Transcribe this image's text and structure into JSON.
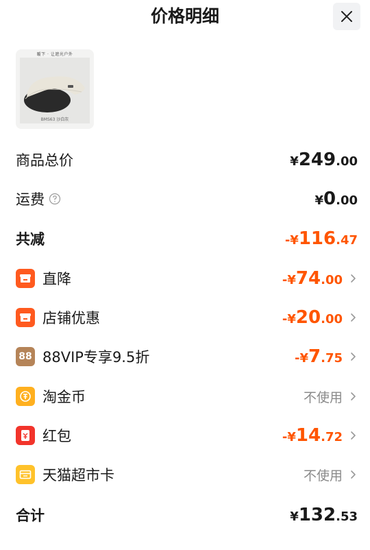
{
  "header": {
    "title": "价格明细"
  },
  "product": {
    "image_top_text": "暖下 · 让遮光户外",
    "image_bottom_text": "BMS63 沙白灰"
  },
  "rows": {
    "subtotal": {
      "label": "商品总价",
      "amount": {
        "sign": "",
        "currency": "¥",
        "integer": "249",
        "decimal": ".00"
      }
    },
    "shipping": {
      "label": "运费",
      "amount": {
        "sign": "",
        "currency": "¥",
        "integer": "0",
        "decimal": ".00"
      }
    },
    "total_reduction": {
      "label": "共减",
      "amount": {
        "sign": "-",
        "currency": "¥",
        "integer": "116",
        "decimal": ".47"
      }
    },
    "direct_discount": {
      "label": "直降",
      "amount": {
        "sign": "-",
        "currency": "¥",
        "integer": "74",
        "decimal": ".00"
      }
    },
    "shop_discount": {
      "label": "店铺优惠",
      "amount": {
        "sign": "-",
        "currency": "¥",
        "integer": "20",
        "decimal": ".00"
      }
    },
    "vip_discount": {
      "label": "88VIP专享9.5折",
      "icon_text": "88",
      "amount": {
        "sign": "-",
        "currency": "¥",
        "integer": "7",
        "decimal": ".75"
      }
    },
    "taojinbi": {
      "label": "淘金币",
      "status": "不使用"
    },
    "red_packet": {
      "label": "红包",
      "amount": {
        "sign": "-",
        "currency": "¥",
        "integer": "14",
        "decimal": ".72"
      }
    },
    "tmall_card": {
      "label": "天猫超市卡",
      "status": "不使用"
    },
    "grand_total": {
      "label": "合计",
      "amount": {
        "sign": "",
        "currency": "¥",
        "integer": "132",
        "decimal": ".53"
      }
    }
  },
  "colors": {
    "discount": "#ff5500",
    "muted": "#8a8a8a",
    "orange_icon": "#ff5a1f",
    "vip_icon": "#b58458",
    "gold_icon": "#ffb01f",
    "red_icon": "#f2342b",
    "yellow_icon": "#ffc22a"
  },
  "icons": [
    "close-icon",
    "help-circle-icon",
    "shop-icon",
    "store-icon",
    "vip-88-icon",
    "coin-icon",
    "red-envelope-icon",
    "card-icon",
    "chevron-right-icon"
  ]
}
